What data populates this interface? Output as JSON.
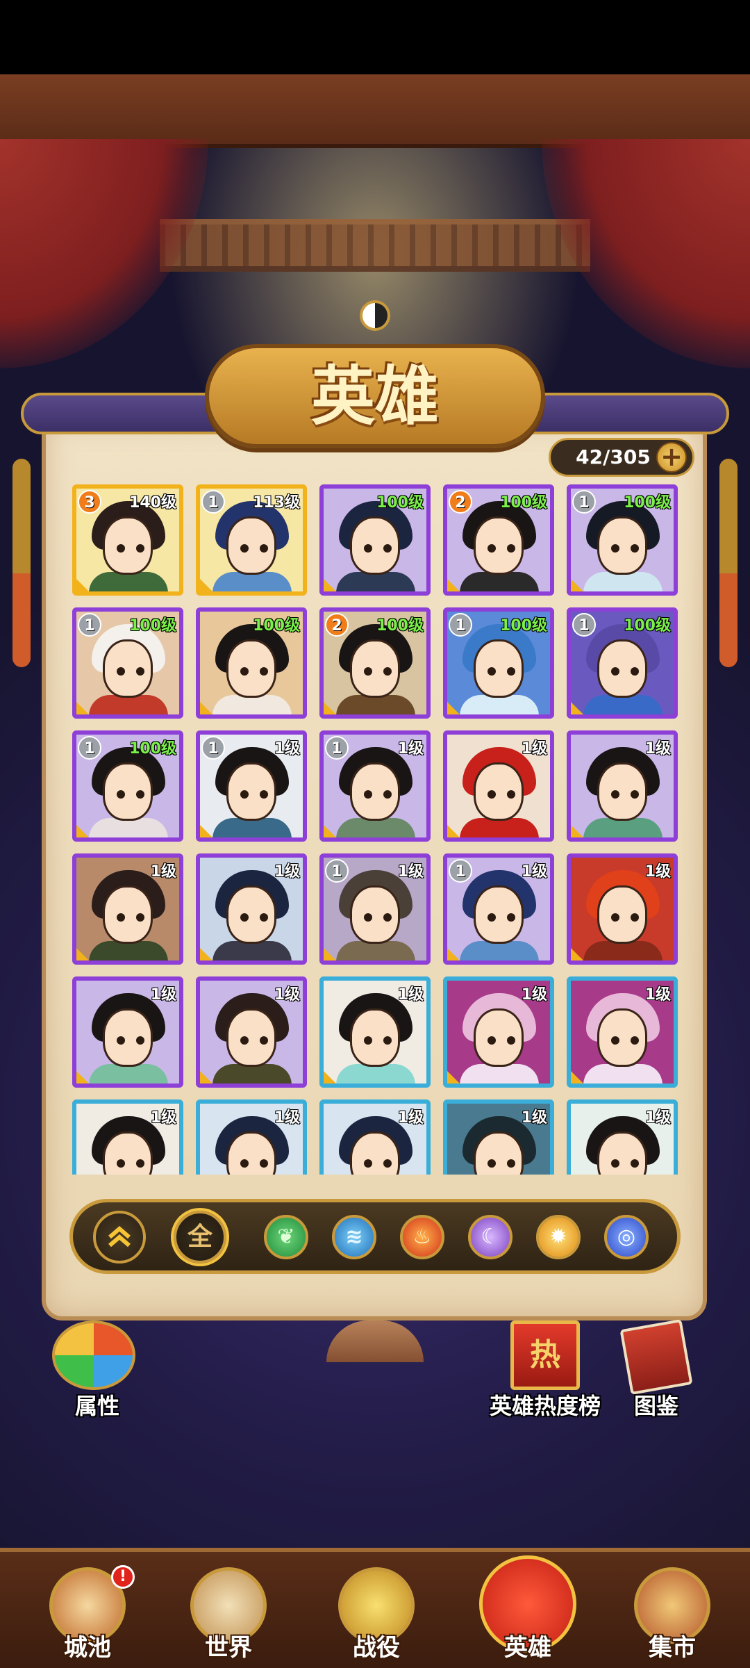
{
  "page": {
    "title": "英雄"
  },
  "hero_count": {
    "text": "42/305",
    "add_label": "+"
  },
  "heroes": [
    {
      "level": "140级",
      "star": "3",
      "star_color": "orange",
      "rarity": "orange",
      "hair": "#2a1d1a",
      "outfit": "#3f6b3a",
      "bg": "#f6e7a4"
    },
    {
      "level": "113级",
      "star": "1",
      "star_color": "silver",
      "rarity": "orange",
      "hair": "#23336b",
      "outfit": "#5a8ec8",
      "bg": "#f6e7a4"
    },
    {
      "level": "100级",
      "star": "",
      "star_color": "",
      "rarity": "purple",
      "hair": "#1c2540",
      "outfit": "#2d3a55",
      "bg": "#c9b7e8"
    },
    {
      "level": "100级",
      "star": "2",
      "star_color": "orange",
      "rarity": "purple",
      "hair": "#1a1515",
      "outfit": "#2a2a2a",
      "bg": "#c9b7e8"
    },
    {
      "level": "100级",
      "star": "1",
      "star_color": "silver",
      "rarity": "purple",
      "hair": "#151a25",
      "outfit": "#cfe6f0",
      "bg": "#c9b7e8"
    },
    {
      "level": "100级",
      "star": "1",
      "star_color": "silver",
      "rarity": "purple",
      "hair": "#f4f0ec",
      "outfit": "#c23a2a",
      "bg": "#e6c8a8"
    },
    {
      "level": "100级",
      "star": "",
      "star_color": "",
      "rarity": "purple",
      "hair": "#1a1515",
      "outfit": "#f1e9e0",
      "bg": "#e8c89a"
    },
    {
      "level": "100级",
      "star": "2",
      "star_color": "orange",
      "rarity": "purple",
      "hair": "#1a1515",
      "outfit": "#6b4a2a",
      "bg": "#d8c4a0"
    },
    {
      "level": "100级",
      "star": "1",
      "star_color": "silver",
      "rarity": "purple",
      "hair": "#3a7ac8",
      "outfit": "#d8ecf8",
      "bg": "#5a8ad8"
    },
    {
      "level": "100级",
      "star": "1",
      "star_color": "silver",
      "rarity": "purple",
      "hair": "#5a4aa8",
      "outfit": "#3a6ac8",
      "bg": "#6a5ac0"
    },
    {
      "level": "100级",
      "star": "1",
      "star_color": "silver",
      "rarity": "purple",
      "hair": "#1a1515",
      "outfit": "#e8e0e0",
      "bg": "#c9b7e8"
    },
    {
      "level": "1级",
      "star": "1",
      "star_color": "silver",
      "rarity": "purple",
      "hair": "#1a1515",
      "outfit": "#3a6a8a",
      "bg": "#e8ecf0"
    },
    {
      "level": "1级",
      "star": "1",
      "star_color": "silver",
      "rarity": "purple",
      "hair": "#1a1515",
      "outfit": "#6a8a6a",
      "bg": "#c9b7e8"
    },
    {
      "level": "1级",
      "star": "",
      "star_color": "",
      "rarity": "purple",
      "hair": "#c8201a",
      "outfit": "#c8201a",
      "bg": "#f0e0d0"
    },
    {
      "level": "1级",
      "star": "",
      "star_color": "",
      "rarity": "purple",
      "hair": "#1a1515",
      "outfit": "#5aa080",
      "bg": "#c9b7e8"
    },
    {
      "level": "1级",
      "star": "",
      "star_color": "",
      "rarity": "purple",
      "hair": "#2a1d1a",
      "outfit": "#3a4a2a",
      "bg": "#b88a6a"
    },
    {
      "level": "1级",
      "star": "",
      "star_color": "",
      "rarity": "purple",
      "hair": "#1c2540",
      "outfit": "#3a3a4a",
      "bg": "#c9d6e8"
    },
    {
      "level": "1级",
      "star": "1",
      "star_color": "silver",
      "rarity": "purple",
      "hair": "#4a4038",
      "outfit": "#7a6a50",
      "bg": "#b8a8c8"
    },
    {
      "level": "1级",
      "star": "1",
      "star_color": "silver",
      "rarity": "purple",
      "hair": "#23336b",
      "outfit": "#5a8ec8",
      "bg": "#c9b7e8"
    },
    {
      "level": "1级",
      "star": "",
      "star_color": "",
      "rarity": "purple",
      "hair": "#e0401a",
      "outfit": "#8a2a1a",
      "bg": "#c83a2a"
    },
    {
      "level": "1级",
      "star": "",
      "star_color": "",
      "rarity": "purple",
      "hair": "#1a1515",
      "outfit": "#7ac0a0",
      "bg": "#c9b7e8"
    },
    {
      "level": "1级",
      "star": "",
      "star_color": "",
      "rarity": "purple",
      "hair": "#2a1d1a",
      "outfit": "#4a4a2a",
      "bg": "#c9b7e8"
    },
    {
      "level": "1级",
      "star": "",
      "star_color": "",
      "rarity": "blue",
      "hair": "#1a1515",
      "outfit": "#8ad8d0",
      "bg": "#f0ece4"
    },
    {
      "level": "1级",
      "star": "",
      "star_color": "",
      "rarity": "blue",
      "hair": "#e8b8d8",
      "outfit": "#f0e0f0",
      "bg": "#a83a8a"
    },
    {
      "level": "1级",
      "star": "",
      "star_color": "",
      "rarity": "blue",
      "hair": "#e8b8d8",
      "outfit": "#f0e0f0",
      "bg": "#a83a8a"
    },
    {
      "level": "1级",
      "star": "",
      "star_color": "",
      "rarity": "blue",
      "hair": "#1a1515",
      "outfit": "#d0c0b0",
      "bg": "#f0ece4"
    },
    {
      "level": "1级",
      "star": "",
      "star_color": "",
      "rarity": "blue",
      "hair": "#1c2540",
      "outfit": "#3a4a6a",
      "bg": "#d8e4f0"
    },
    {
      "level": "1级",
      "star": "",
      "star_color": "",
      "rarity": "blue",
      "hair": "#1c2540",
      "outfit": "#3a4a6a",
      "bg": "#d8e4f0"
    },
    {
      "level": "1级",
      "star": "",
      "star_color": "",
      "rarity": "blue",
      "hair": "#1a2a30",
      "outfit": "#2a5a6a",
      "bg": "#4a7a90"
    },
    {
      "level": "1级",
      "star": "",
      "star_color": "",
      "rarity": "blue",
      "hair": "#1a1515",
      "outfit": "#a8d8d0",
      "bg": "#e8f0ec"
    }
  ],
  "filters": {
    "sort_icon": "double-chevron-up",
    "all_label": "全",
    "elements": [
      "wood-icon",
      "water-icon",
      "fire-icon",
      "dark-icon",
      "light-icon",
      "wind-icon"
    ]
  },
  "side_buttons": {
    "attribute_label": "属性",
    "ranking_label": "英雄热度榜",
    "ranking_icon_text": "热",
    "codex_label": "图鉴"
  },
  "nav": {
    "city": "城池",
    "world": "世界",
    "battle": "战役",
    "hero": "英雄",
    "market": "集市",
    "city_badge": "!"
  }
}
